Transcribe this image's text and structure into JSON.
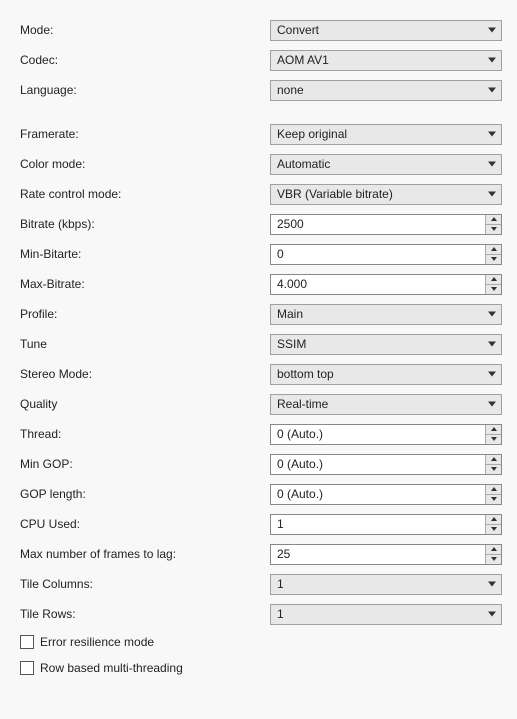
{
  "labels": {
    "mode": "Mode:",
    "codec": "Codec:",
    "language": "Language:",
    "framerate": "Framerate:",
    "colormode": "Color mode:",
    "ratecontrol": "Rate control mode:",
    "bitrate": "Bitrate (kbps):",
    "minbitrate": "Min-Bitarte:",
    "maxbitrate": "Max-Bitrate:",
    "profile": "Profile:",
    "tune": "Tune",
    "stereomode": "Stereo Mode:",
    "quality": "Quality",
    "thread": "Thread:",
    "mingop": "Min GOP:",
    "goplength": "GOP length:",
    "cpuused": "CPU Used:",
    "maxlag": "Max number of frames to lag:",
    "tilecols": "Tile Columns:",
    "tilerows": "Tile Rows:",
    "errres": "Error resilience mode",
    "rowmt": "Row based multi-threading"
  },
  "values": {
    "mode": "Convert",
    "codec": "AOM AV1",
    "language": "none",
    "framerate": "Keep original",
    "colormode": "Automatic",
    "ratecontrol": "VBR (Variable bitrate)",
    "bitrate": "2500",
    "minbitrate": "0",
    "maxbitrate": "4.000",
    "profile": "Main",
    "tune": "SSIM",
    "stereomode": "bottom top",
    "quality": "Real-time",
    "thread": "0 (Auto.)",
    "mingop": "0 (Auto.)",
    "goplength": "0 (Auto.)",
    "cpuused": "1",
    "maxlag": "25",
    "tilecols": "1",
    "tilerows": "1"
  }
}
